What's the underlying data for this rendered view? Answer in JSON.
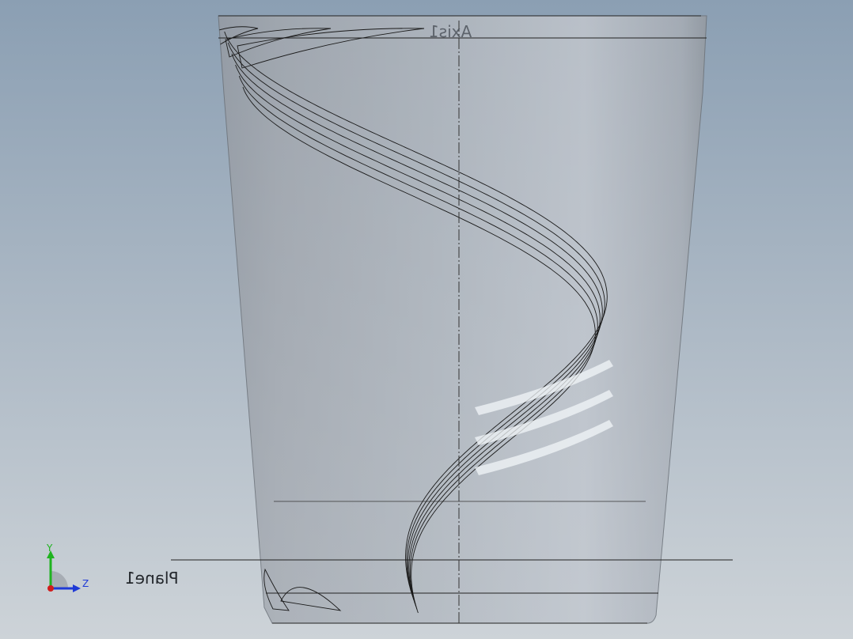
{
  "viewport": {
    "labels": {
      "axis": "Axis1",
      "plane": "Plane1"
    },
    "triad": {
      "y_label": "Y",
      "z_label": "Z",
      "colors": {
        "x": "#d11c1c",
        "y": "#1fb31f",
        "z": "#1f3ad6"
      }
    },
    "colors": {
      "background_top": "#8b9fb3",
      "background_bottom": "#cdd3d8",
      "model_fill": "#a8b0b9",
      "edge": "#1a1a1a",
      "highlight": "#f2f5f8"
    },
    "model": {
      "type": "tapered cylinder with helical sweep",
      "helix_strands": 6
    }
  }
}
